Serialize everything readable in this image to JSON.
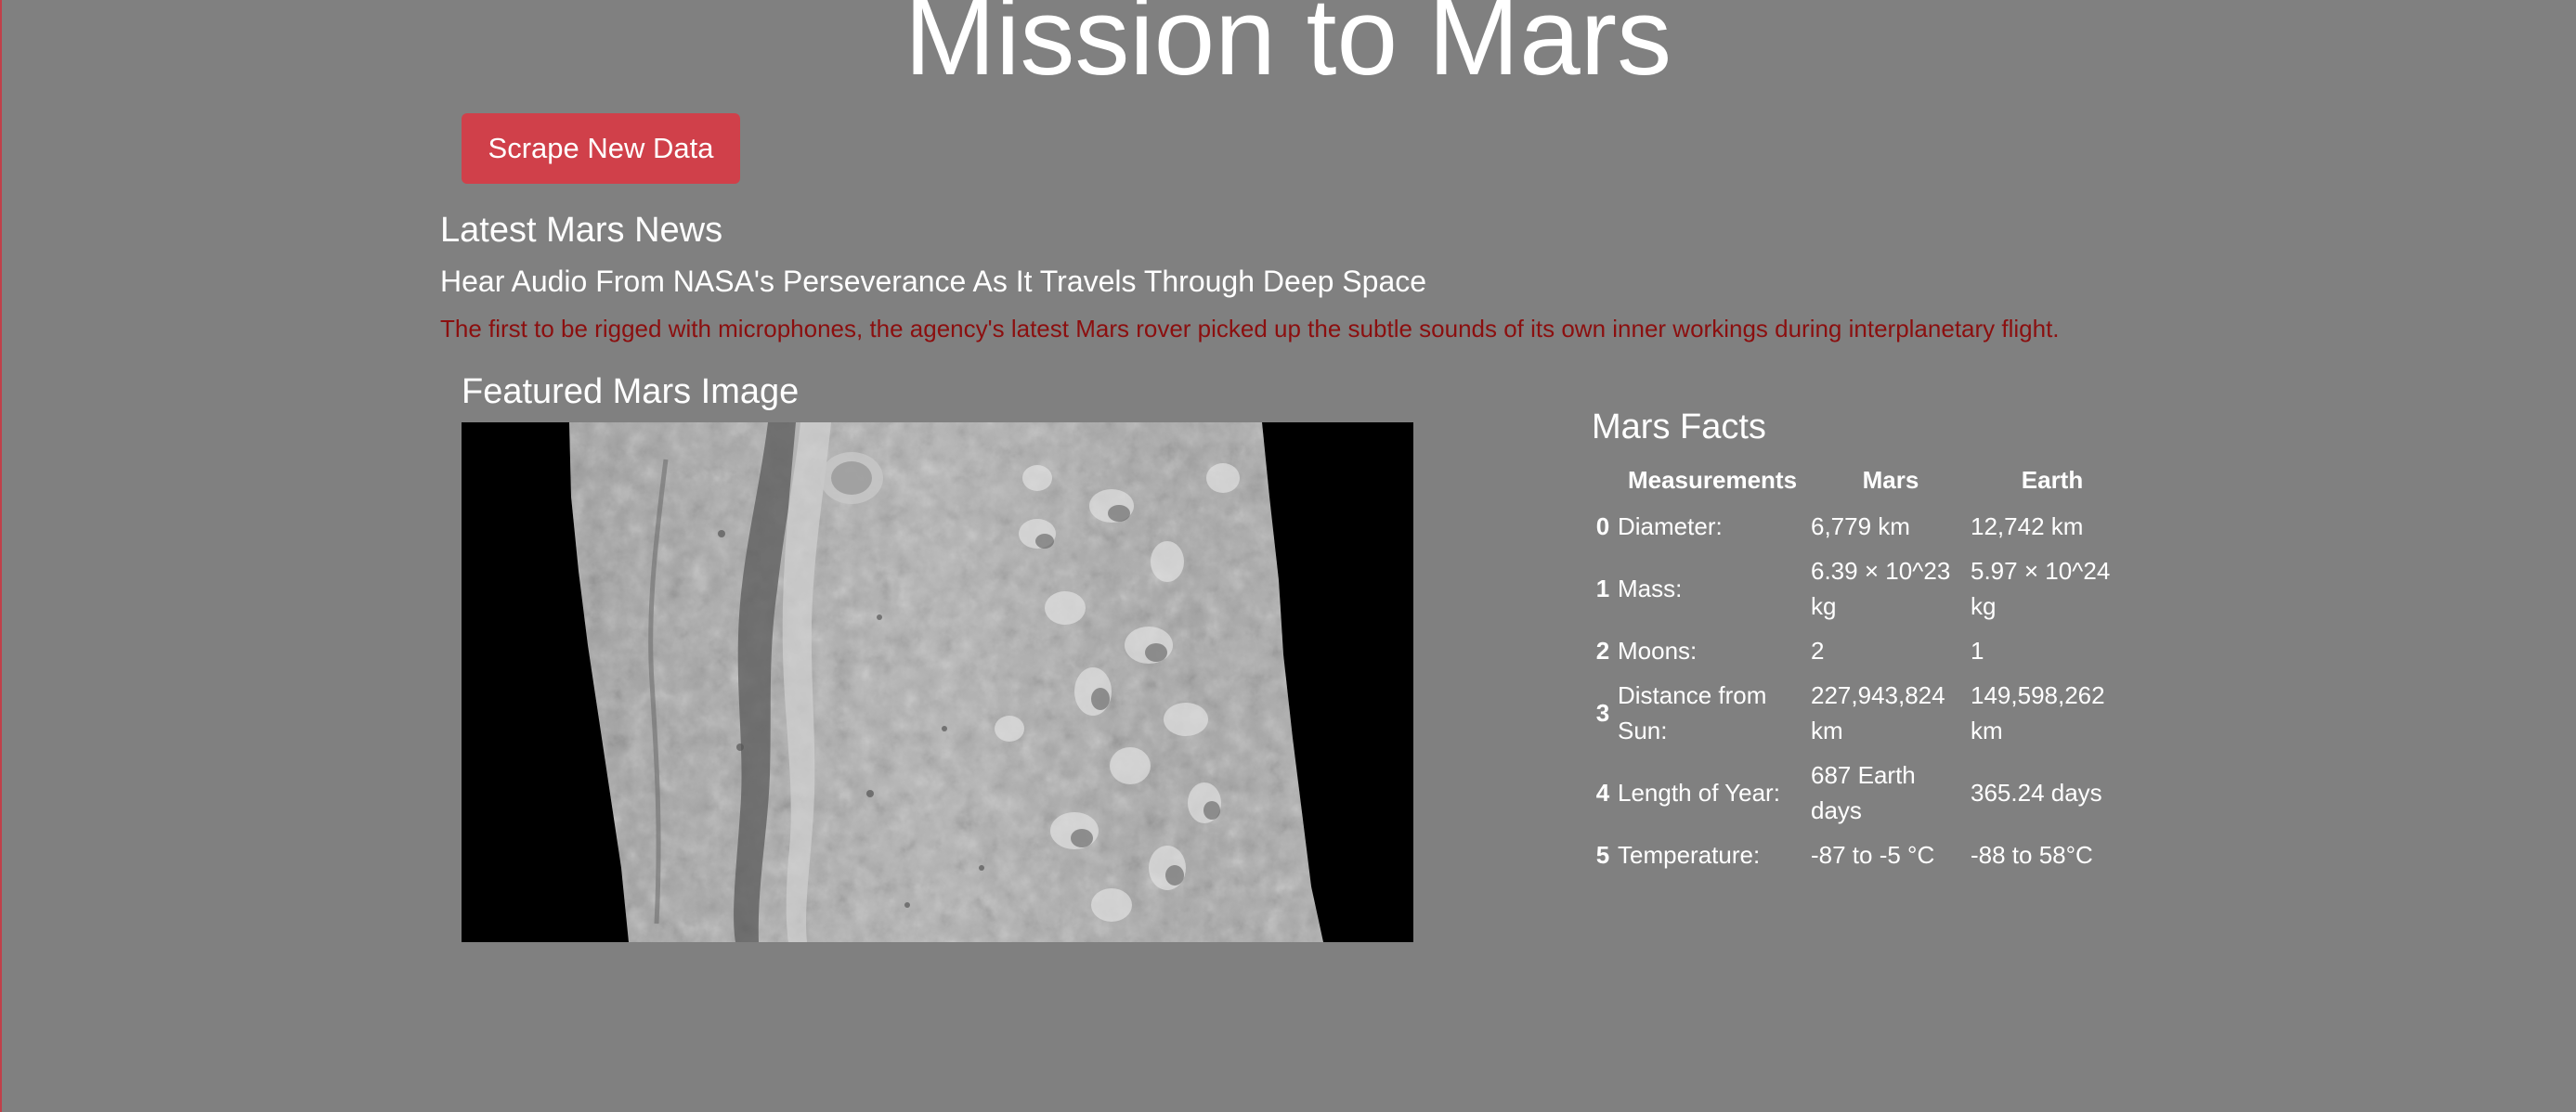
{
  "header": {
    "title": "Mission to Mars"
  },
  "actions": {
    "scrape_label": "Scrape New Data"
  },
  "news": {
    "heading": "Latest Mars News",
    "title": "Hear Audio From NASA's Perseverance As It Travels Through Deep Space",
    "teaser": "The first to be rigged with microphones, the agency's latest Mars rover picked up the subtle sounds of its own inner workings during interplanetary flight."
  },
  "featured": {
    "heading": "Featured Mars Image"
  },
  "facts": {
    "heading": "Mars Facts",
    "columns": [
      "",
      "Measurements",
      "Mars",
      "Earth"
    ],
    "rows": [
      {
        "index": "0",
        "label": "Diameter:",
        "mars": "6,779 km",
        "earth": "12,742 km"
      },
      {
        "index": "1",
        "label": "Mass:",
        "mars": "6.39 × 10^23 kg",
        "earth": "5.97 × 10^24 kg"
      },
      {
        "index": "2",
        "label": "Moons:",
        "mars": "2",
        "earth": "1"
      },
      {
        "index": "3",
        "label": "Distance from Sun:",
        "mars": "227,943,824 km",
        "earth": "149,598,262 km"
      },
      {
        "index": "4",
        "label": "Length of Year:",
        "mars": "687 Earth days",
        "earth": "365.24 days"
      },
      {
        "index": "5",
        "label": "Temperature:",
        "mars": "-87 to -5 °C",
        "earth": "-88 to 58°C"
      }
    ]
  },
  "colors": {
    "background": "#808080",
    "button": "#d0404a",
    "teaser_text": "#8b0f0f",
    "text": "#ffffff"
  }
}
